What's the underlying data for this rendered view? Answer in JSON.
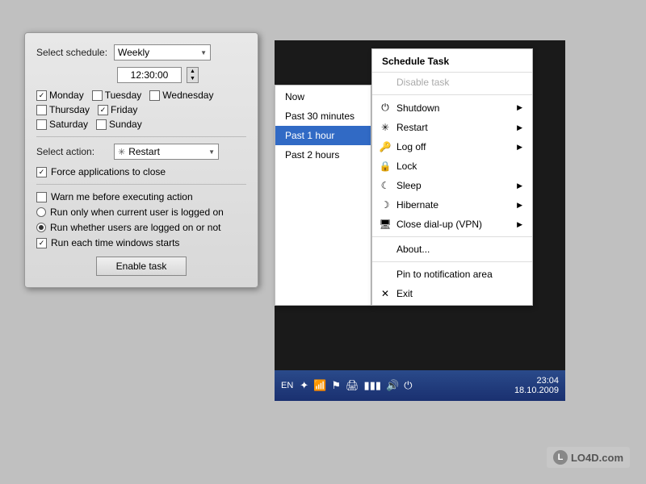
{
  "left_panel": {
    "schedule_label": "Select schedule:",
    "schedule_value": "Weekly",
    "time_value": "12:30:00",
    "days": [
      {
        "label": "Monday",
        "checked": true
      },
      {
        "label": "Tuesday",
        "checked": false
      },
      {
        "label": "Wednesday",
        "checked": false
      },
      {
        "label": "Thursday",
        "checked": false
      },
      {
        "label": "Friday",
        "checked": true
      },
      {
        "label": "Saturday",
        "checked": false
      },
      {
        "label": "Sunday",
        "checked": false
      }
    ],
    "action_label": "Select action:",
    "action_value": "Restart",
    "force_close_label": "Force applications to close",
    "force_close_checked": true,
    "warn_label": "Warn me before executing action",
    "warn_checked": false,
    "run_logged_on_label": "Run only when current user is logged on",
    "run_logged_on_selected": false,
    "run_any_label": "Run whether users are logged on or not",
    "run_any_selected": true,
    "run_windows_label": "Run each time windows starts",
    "run_windows_checked": true,
    "enable_btn_label": "Enable task"
  },
  "right_panel": {
    "menu_title": "Schedule Task",
    "disable_label": "Disable task",
    "submenu_items": [
      {
        "label": "Now",
        "selected": false
      },
      {
        "label": "Past 30 minutes",
        "selected": false
      },
      {
        "label": "Past 1 hour",
        "selected": true
      },
      {
        "label": "Past 2 hours",
        "selected": false
      }
    ],
    "menu_items": [
      {
        "label": "Shutdown",
        "icon": "⏻",
        "has_arrow": true,
        "disabled": false
      },
      {
        "label": "Restart",
        "icon": "✳",
        "has_arrow": true,
        "disabled": false
      },
      {
        "label": "Log off",
        "icon": "🔑",
        "has_arrow": true,
        "disabled": false
      },
      {
        "label": "Lock",
        "icon": "🔒",
        "has_arrow": false,
        "disabled": false
      },
      {
        "label": "Sleep",
        "icon": "☾",
        "has_arrow": true,
        "disabled": false
      },
      {
        "label": "Hibernate",
        "icon": "☾",
        "has_arrow": true,
        "disabled": false
      },
      {
        "label": "Close dial-up (VPN)",
        "icon": "🖨",
        "has_arrow": true,
        "disabled": false
      }
    ],
    "about_label": "About...",
    "pin_label": "Pin to notification area",
    "exit_label": "Exit",
    "taskbar": {
      "lang": "EN",
      "time": "23:04",
      "date": "18.10.2009"
    }
  },
  "watermark": {
    "logo": "L",
    "text": "LO4D.com"
  }
}
